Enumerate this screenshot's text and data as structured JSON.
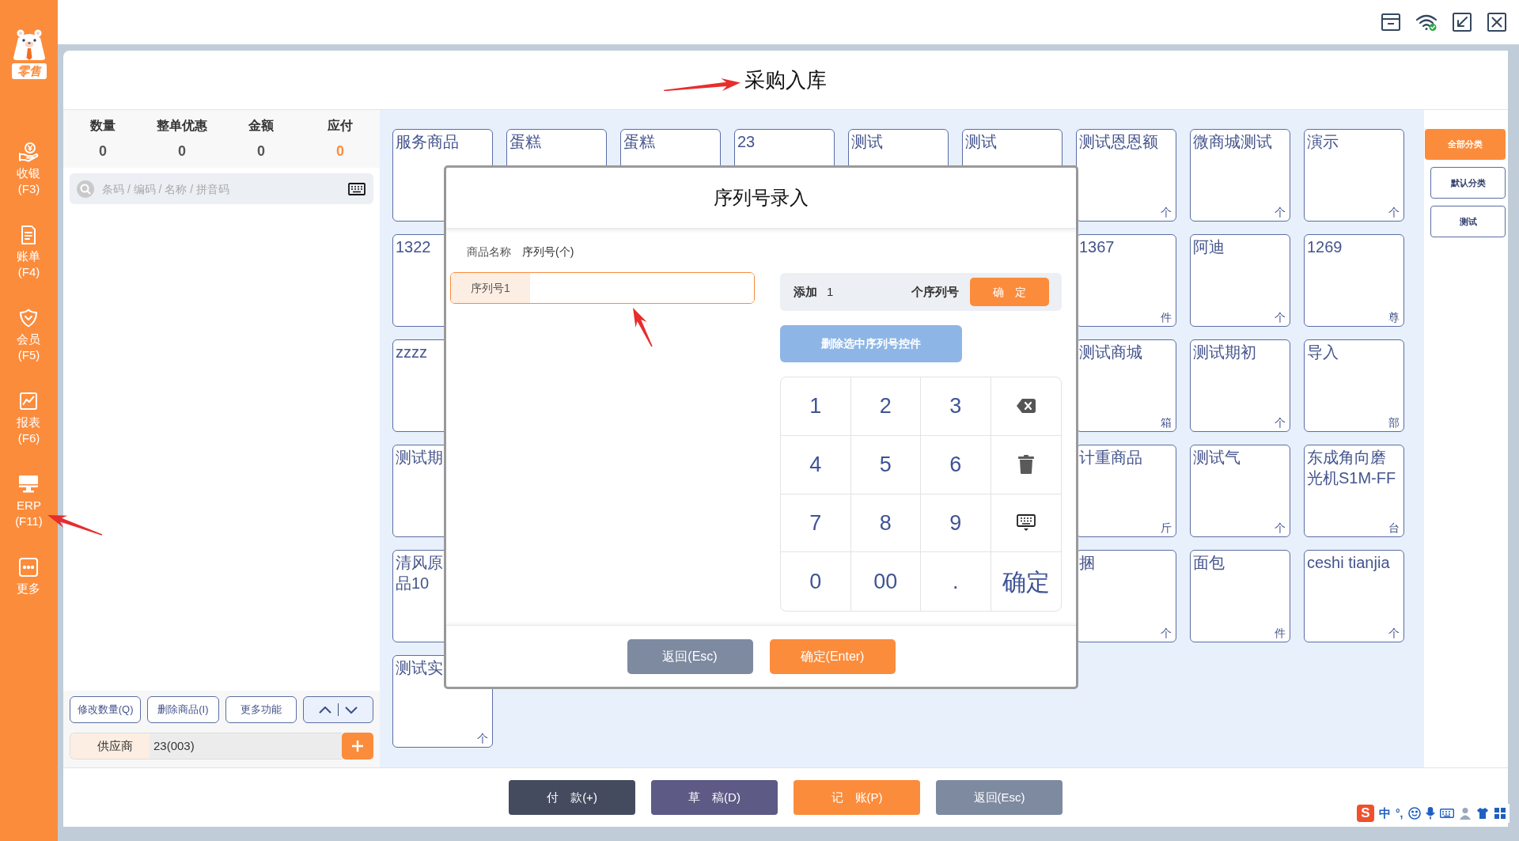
{
  "sidebar": {
    "logo_text": "零售",
    "items": [
      {
        "kind": "cashier",
        "label": "收银",
        "shortcut": "(F3)"
      },
      {
        "kind": "bills",
        "label": "账单",
        "shortcut": "(F4)"
      },
      {
        "kind": "member",
        "label": "会员",
        "shortcut": "(F5)"
      },
      {
        "kind": "report",
        "label": "报表",
        "shortcut": "(F6)"
      },
      {
        "kind": "erp",
        "label": "ERP",
        "shortcut": "(F11)"
      },
      {
        "kind": "more",
        "label": "更多"
      }
    ]
  },
  "page_title": "采购入库",
  "summary": [
    {
      "label": "数量",
      "value": "0",
      "highlighted": false
    },
    {
      "label": "整单优惠",
      "value": "0",
      "highlighted": false
    },
    {
      "label": "金额",
      "value": "0",
      "highlighted": false
    },
    {
      "label": "应付",
      "value": "0",
      "highlighted": true
    }
  ],
  "search": {
    "placeholder": "条码 / 编码 / 名称 / 拼音码"
  },
  "cart_actions": [
    {
      "label": "修改数量(Q)"
    },
    {
      "label": "删除商品(I)"
    },
    {
      "label": "更多功能"
    }
  ],
  "supplier": {
    "label": "供应商",
    "value": "23(003)"
  },
  "product_rows": [
    {
      "left": [
        {
          "name": "服务商品"
        },
        {
          "name": "蛋糕"
        },
        {
          "name": "蛋糕"
        },
        {
          "name": "23"
        },
        {
          "name": "测试"
        },
        {
          "name": "测试"
        }
      ],
      "right": [
        {
          "name": "测试恩恩额",
          "unit": "个"
        },
        {
          "name": "微商城测试",
          "unit": "个"
        },
        {
          "name": "演示",
          "unit": "个"
        }
      ]
    },
    {
      "left": [
        {
          "name": "1322"
        }
      ],
      "right": [
        {
          "name": "1367",
          "unit": "件"
        },
        {
          "name": "阿迪",
          "unit": "个"
        },
        {
          "name": "1269",
          "unit": "尊"
        }
      ]
    },
    {
      "left": [
        {
          "name": "zzzz"
        }
      ],
      "right": [
        {
          "name": "测试商城",
          "unit": "箱"
        },
        {
          "name": "测试期初",
          "unit": "个"
        },
        {
          "name": "导入",
          "unit": "部"
        }
      ]
    },
    {
      "left": [
        {
          "name": "测试期"
        }
      ],
      "right": [
        {
          "name": "计重商品",
          "unit": "斤"
        },
        {
          "name": "测试气",
          "unit": "个"
        },
        {
          "name": "东成角向磨光机S1M-FF",
          "unit": "台"
        }
      ]
    },
    {
      "left": [
        {
          "name": "清风原品10"
        }
      ],
      "right": [
        {
          "name": "捆",
          "unit": "个"
        },
        {
          "name": "面包",
          "unit": "件"
        },
        {
          "name": "ceshi tianjia",
          "unit": "个"
        }
      ]
    },
    {
      "left": [
        {
          "name": "测试实",
          "unit": "个"
        }
      ],
      "right": []
    }
  ],
  "categories": [
    {
      "label": "全部分类",
      "selected": true
    },
    {
      "label": "默认分类",
      "selected": false
    },
    {
      "label": "测试",
      "selected": false
    }
  ],
  "footer_buttons": [
    {
      "kind": "pay",
      "label": "付　款(+)"
    },
    {
      "kind": "draft",
      "label": "草　稿(D)"
    },
    {
      "kind": "post",
      "label": "记　账(P)"
    },
    {
      "kind": "back",
      "label": "返回(Esc)"
    }
  ],
  "dialog": {
    "title": "序列号录入",
    "product_label": "商品名称",
    "product_value": "序列号(个)",
    "serial_fields": [
      {
        "label": "序列号1"
      }
    ],
    "add": {
      "label": "添加",
      "count": "1",
      "suffix": "个序列号",
      "button": "确　定"
    },
    "delete_button": "删除选中序列号控件",
    "keypad": [
      {
        "kind": "key",
        "label": "1"
      },
      {
        "kind": "key",
        "label": "2"
      },
      {
        "kind": "key",
        "label": "3"
      },
      {
        "kind": "backspace"
      },
      {
        "kind": "key",
        "label": "4"
      },
      {
        "kind": "key",
        "label": "5"
      },
      {
        "kind": "key",
        "label": "6"
      },
      {
        "kind": "clear"
      },
      {
        "kind": "key",
        "label": "7"
      },
      {
        "kind": "key",
        "label": "8"
      },
      {
        "kind": "key",
        "label": "9"
      },
      {
        "kind": "keyboard"
      },
      {
        "kind": "key",
        "label": "0"
      },
      {
        "kind": "key",
        "label": "00"
      },
      {
        "kind": "key",
        "label": "."
      },
      {
        "kind": "enter",
        "label": "确定"
      }
    ],
    "buttons": [
      {
        "kind": "cancel",
        "label": "返回(Esc)"
      },
      {
        "kind": "confirm",
        "label": "确定(Enter)"
      }
    ]
  },
  "ime_bar": {
    "logo": "S",
    "mode": "中",
    "punctuation": "°,"
  }
}
